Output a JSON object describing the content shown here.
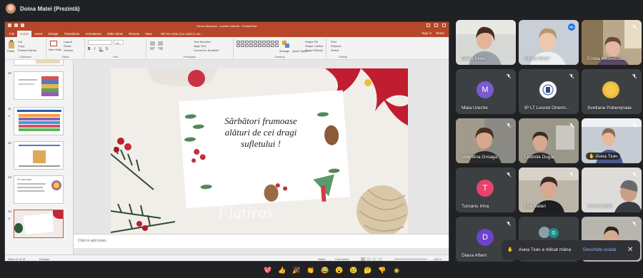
{
  "meeting": {
    "presenter_label": "Doina Matei (Prezintă)"
  },
  "powerpoint": {
    "window_title": "Pauze dinamice - conduit metodic - PowerPoint",
    "tabs": [
      "File",
      "Home",
      "Insert",
      "Design",
      "Transitions",
      "Animations",
      "Slide Show",
      "Review",
      "View"
    ],
    "tell_me": "Tell me what you want to do...",
    "sign_in": "Sign in",
    "share": "Share",
    "ribbon": {
      "paste": "Paste",
      "cut": "Cut",
      "copy": "Copy",
      "format_painter": "Format Painter",
      "clipboard": "Clipboard",
      "new_slide": "New Slide",
      "layout": "Layout",
      "reset": "Reset",
      "section": "Section",
      "slides": "Slides",
      "font": "Font",
      "font_size": "15",
      "paragraph": "Paragraph",
      "text_direction": "Text Direction",
      "align_text": "Align Text",
      "convert_smartart": "Convert to SmartArt",
      "drawing": "Drawing",
      "arrange": "Arrange",
      "quick_styles": "Quick Styles",
      "shape_fill": "Shape Fill",
      "shape_outline": "Shape Outline",
      "shape_effects": "Shape Effects",
      "find": "Find",
      "replace": "Replace",
      "select": "Select",
      "editing": "Editing"
    },
    "thumbnails": [
      {
        "num": "10"
      },
      {
        "num": "11"
      },
      {
        "num": "12"
      },
      {
        "num": "13",
        "text": "Ce concluzie"
      },
      {
        "num": "14",
        "selected": true
      }
    ],
    "slide": {
      "line1": "Sărbători frumoase",
      "line2": "alături de cei dragi",
      "line3": "sufletului !",
      "watermark": "Flatiras"
    },
    "notes_placeholder": "Click to add notes",
    "status": {
      "slide_of": "Slide 14 of 14",
      "language": "Russian",
      "notes": "Notes",
      "comments": "Comments",
      "zoom": "115 %"
    }
  },
  "participants": [
    {
      "name": "Doina Matei",
      "muted": false,
      "has_video": true,
      "speaking": false
    },
    {
      "name": "Albina Nina*",
      "muted": false,
      "has_video": true,
      "speaking": true
    },
    {
      "name": "Emilia Medvetcaia",
      "muted": true,
      "has_video": true,
      "speaking": false
    },
    {
      "name": "Maia Ureche",
      "muted": true,
      "has_video": false,
      "initial": "M",
      "avatar_color": "#7b5ad1"
    },
    {
      "name": "IP LT Leonid Gherm...",
      "muted": true,
      "has_video": false,
      "logo": true
    },
    {
      "name": "Svetlana Poberejnaia",
      "muted": true,
      "has_video": false,
      "photo_avatar": true
    },
    {
      "name": "Valentina Groaga",
      "muted": true,
      "has_video": true
    },
    {
      "name": "Ludmila Dugan",
      "muted": true,
      "has_video": true
    },
    {
      "name": "Анна Ткач",
      "muted": true,
      "has_video": true,
      "hand_raised": true
    },
    {
      "name": "Turcanu Irina",
      "muted": true,
      "has_video": false,
      "initial": "T",
      "avatar_color": "#e8436d"
    },
    {
      "name": "Lilia Salari",
      "muted": true,
      "has_video": true
    },
    {
      "name": "Viorel Cateli",
      "muted": true,
      "has_video": true
    },
    {
      "name": "Diana Afteni",
      "muted": true,
      "has_video": false,
      "initial": "D",
      "avatar_color": "#6b44c8"
    },
    {
      "name": "",
      "muted": true,
      "has_video": false,
      "initial": "G",
      "avatar_color": "#1e8e8e"
    },
    {
      "name": "",
      "muted": true,
      "has_video": true
    }
  ],
  "notification": {
    "message": "Анна Ткач a ridicat mâna",
    "action": "Deschide coada"
  },
  "reactions": [
    "💖",
    "👍",
    "🎉",
    "👏",
    "😂",
    "😮",
    "😢",
    "🤔",
    "👎"
  ],
  "colors": {
    "ppt_accent": "#b7472a",
    "meet_bg": "#202124",
    "tile_bg": "#3c4043",
    "link": "#8ab4f8"
  }
}
